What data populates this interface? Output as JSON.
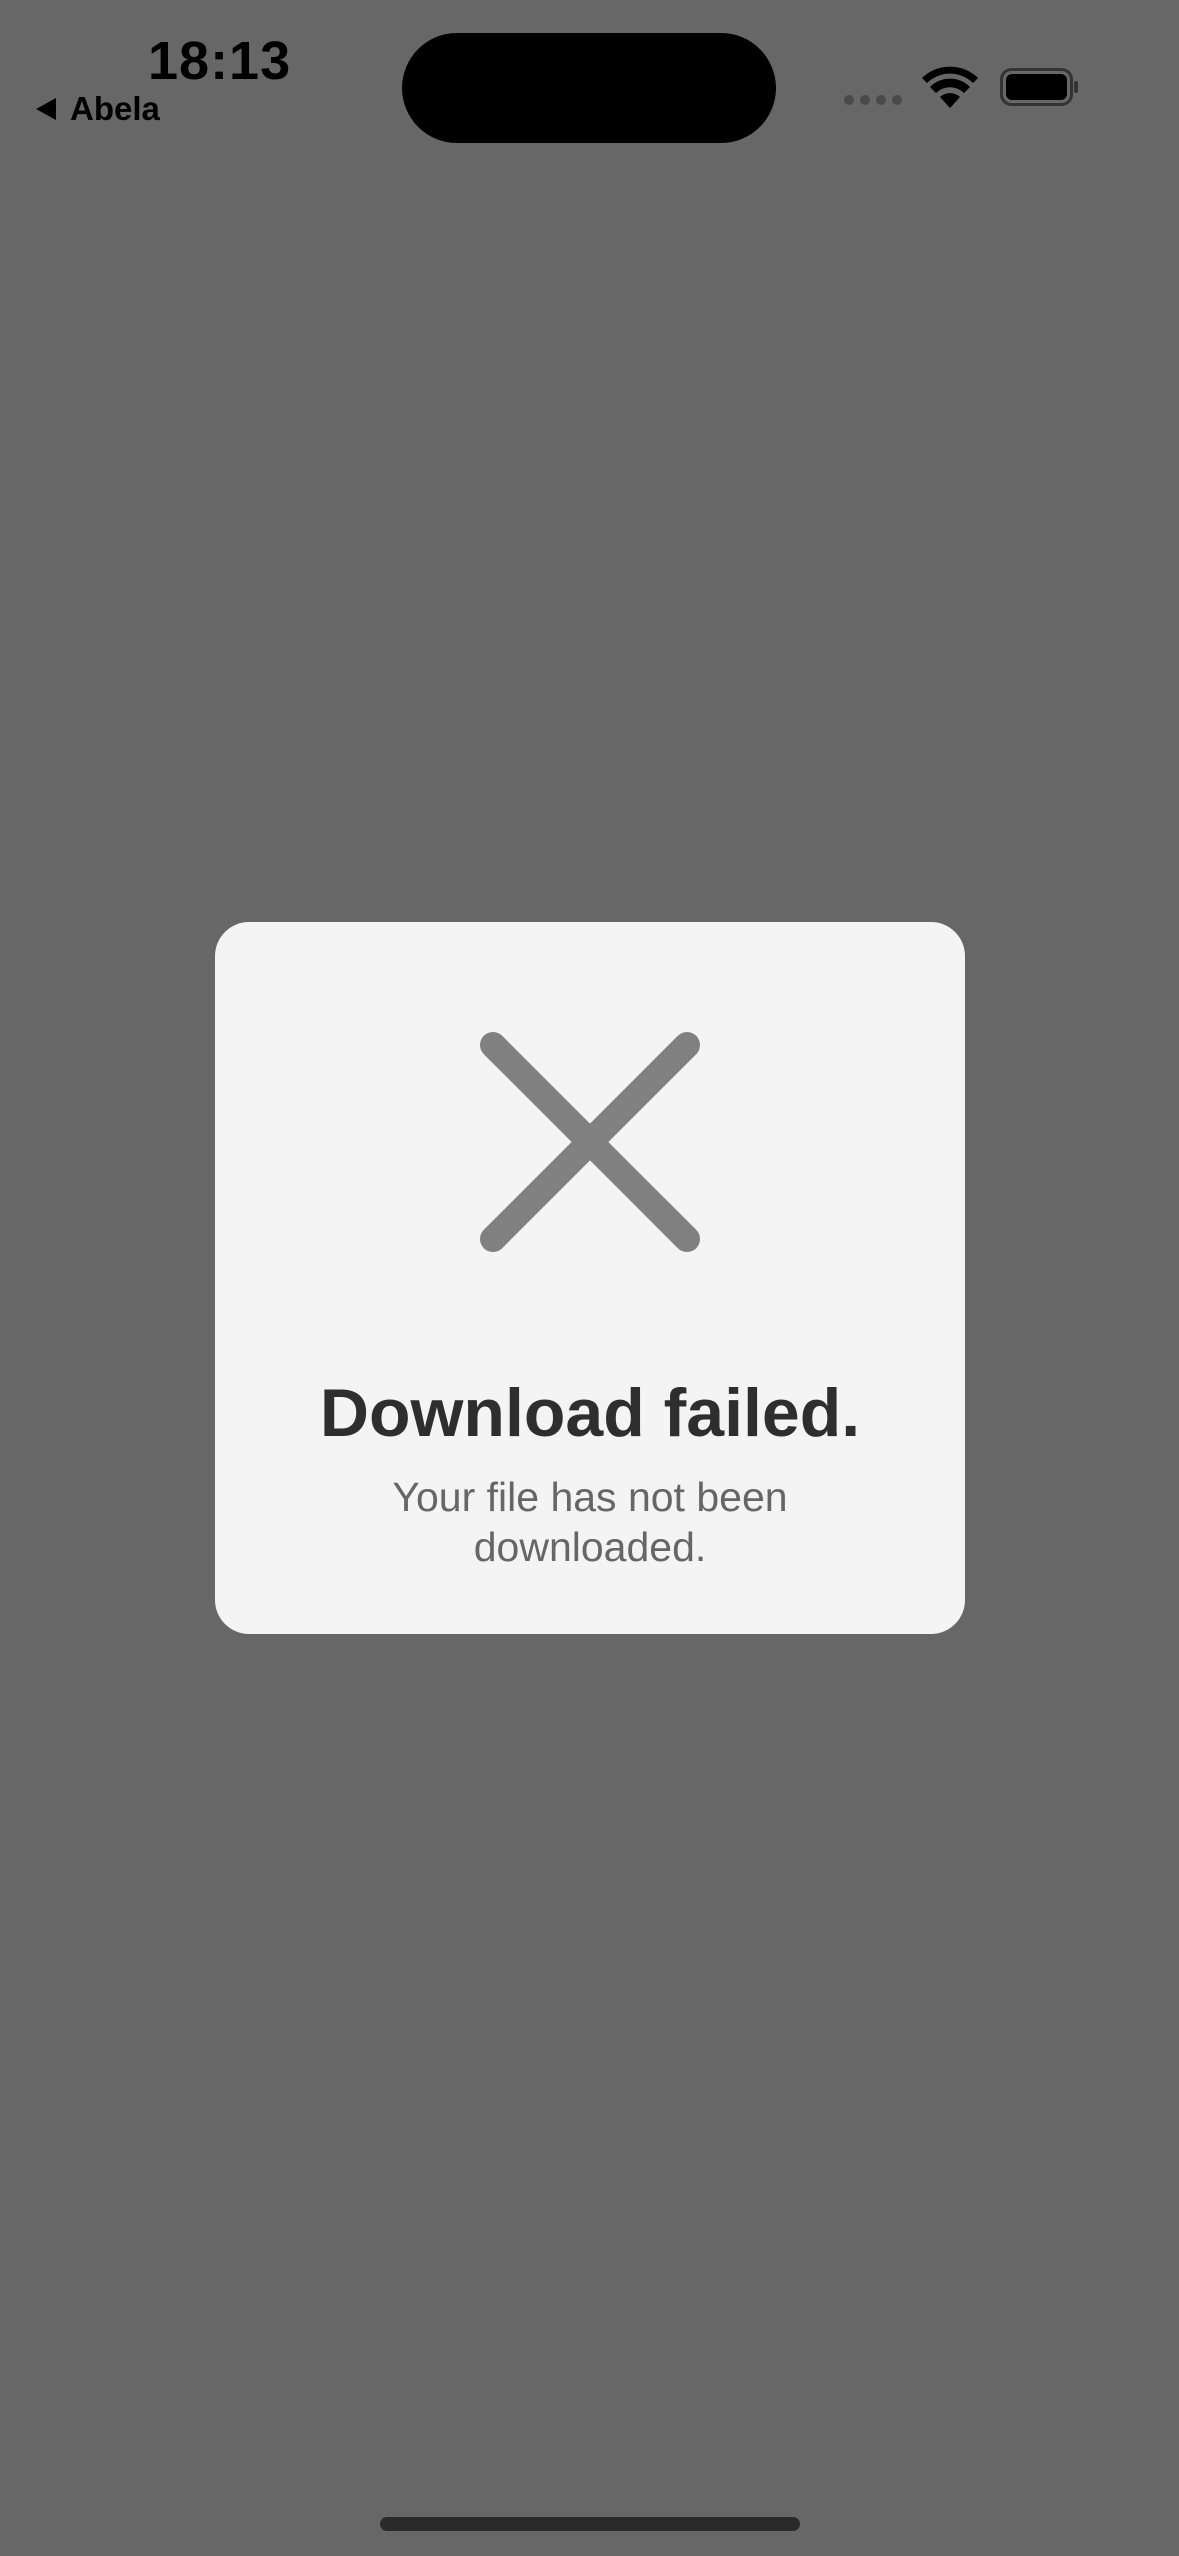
{
  "status_bar": {
    "time": "18:13",
    "back_app": "Abela"
  },
  "dialog": {
    "icon": "close-x-icon",
    "title": "Download failed.",
    "message": "Your file has not been downloaded."
  },
  "colors": {
    "background": "#676767",
    "dialog_bg": "#f4f4f4",
    "icon": "#808080",
    "title": "#2e2e2e",
    "message": "#666666"
  }
}
